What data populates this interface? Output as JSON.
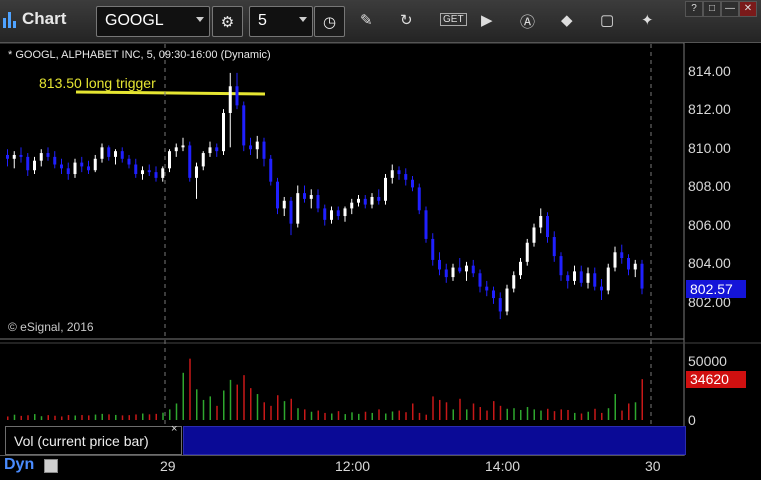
{
  "toolbar": {
    "app_title": "Chart",
    "symbol": "GOOGL",
    "interval": "5",
    "icons": [
      "chart-bars-icon",
      "symbol-dropdown-icon",
      "settings-gear-icon",
      "interval-dropdown-icon",
      "clock-icon",
      "draw-pencil-icon",
      "refresh-icon",
      "get-data-icon",
      "play-icon",
      "autoscale-a-icon",
      "tools-icon",
      "message-icon",
      "twitter-icon"
    ],
    "window_buttons": [
      "?",
      "□",
      "—",
      "✕"
    ]
  },
  "chart": {
    "header": "* GOOGL, ALPHABET INC, 5, 09:30-16:00 (Dynamic)",
    "annotation": "813.50 long trigger",
    "copyright": "© eSignal, 2016",
    "price_axis": [
      "814.00",
      "812.00",
      "810.00",
      "808.00",
      "806.00",
      "804.00",
      "802.00"
    ],
    "last_price": "802.57",
    "volume_axis": [
      "50000",
      "0"
    ],
    "last_volume": "34620",
    "volume_label": "Vol (current price bar)",
    "volume_close": "×",
    "time_axis": [
      "29",
      "12:00",
      "14:00",
      "30"
    ],
    "mode": "Dyn",
    "colors": {
      "up": "#ffffff",
      "down": "#2020ff",
      "annotation": "#e6e632",
      "vol_up": "#2ea82e",
      "vol_down": "#c81818",
      "price_tag": "#1414d8",
      "volume_tag": "#d01010"
    }
  },
  "chart_data": {
    "type": "candlestick",
    "symbol": "GOOGL",
    "interval_minutes": 5,
    "ylim": [
      801,
      814.5
    ],
    "ohlc": [
      [
        809.6,
        809.9,
        809.0,
        809.4
      ],
      [
        809.4,
        809.8,
        808.9,
        809.6
      ],
      [
        809.6,
        810.0,
        809.2,
        809.5
      ],
      [
        809.5,
        809.7,
        808.5,
        808.8
      ],
      [
        808.8,
        809.5,
        808.6,
        809.3
      ],
      [
        809.3,
        809.9,
        809.0,
        809.7
      ],
      [
        809.7,
        810.0,
        809.3,
        809.5
      ],
      [
        809.5,
        809.8,
        808.9,
        809.1
      ],
      [
        809.1,
        809.4,
        808.6,
        808.9
      ],
      [
        808.9,
        809.2,
        808.3,
        808.6
      ],
      [
        808.6,
        809.4,
        808.4,
        809.2
      ],
      [
        809.2,
        809.5,
        808.7,
        809.0
      ],
      [
        809.0,
        809.3,
        808.6,
        808.8
      ],
      [
        808.8,
        809.6,
        808.7,
        809.4
      ],
      [
        809.4,
        810.2,
        809.2,
        810.0
      ],
      [
        810.0,
        810.1,
        809.3,
        809.5
      ],
      [
        809.5,
        809.9,
        809.1,
        809.8
      ],
      [
        809.8,
        810.0,
        809.2,
        809.4
      ],
      [
        809.4,
        809.6,
        808.9,
        809.1
      ],
      [
        809.1,
        809.4,
        808.4,
        808.6
      ],
      [
        808.6,
        809.0,
        808.3,
        808.8
      ],
      [
        808.8,
        809.1,
        808.5,
        808.7
      ],
      [
        808.7,
        809.0,
        808.2,
        808.4
      ],
      [
        808.4,
        809.0,
        808.2,
        808.9
      ],
      [
        808.9,
        809.9,
        808.7,
        809.8
      ],
      [
        809.8,
        810.2,
        809.5,
        810.0
      ],
      [
        810.0,
        810.5,
        809.8,
        810.1
      ],
      [
        810.1,
        810.3,
        808.2,
        808.4
      ],
      [
        808.4,
        809.2,
        807.3,
        809.0
      ],
      [
        809.0,
        809.8,
        808.8,
        809.7
      ],
      [
        809.7,
        810.3,
        809.5,
        810.0
      ],
      [
        810.0,
        810.2,
        809.5,
        809.8
      ],
      [
        809.8,
        812.0,
        809.6,
        811.8
      ],
      [
        811.8,
        813.9,
        810.0,
        813.2
      ],
      [
        813.2,
        813.9,
        812.0,
        812.2
      ],
      [
        812.2,
        812.4,
        809.8,
        810.1
      ],
      [
        810.1,
        810.5,
        809.6,
        809.9
      ],
      [
        809.9,
        810.6,
        809.4,
        810.3
      ],
      [
        810.3,
        810.5,
        809.0,
        809.4
      ],
      [
        809.4,
        809.6,
        808.0,
        808.2
      ],
      [
        808.2,
        808.4,
        806.5,
        806.8
      ],
      [
        806.8,
        807.4,
        806.4,
        807.2
      ],
      [
        807.2,
        807.4,
        805.4,
        806.0
      ],
      [
        806.0,
        808.0,
        805.8,
        807.6
      ],
      [
        807.6,
        808.0,
        807.1,
        807.3
      ],
      [
        807.3,
        807.8,
        806.8,
        807.5
      ],
      [
        807.5,
        807.8,
        806.6,
        806.8
      ],
      [
        806.8,
        807.0,
        805.9,
        806.2
      ],
      [
        806.2,
        806.9,
        806.0,
        806.7
      ],
      [
        806.7,
        806.9,
        806.2,
        806.4
      ],
      [
        806.4,
        806.9,
        806.1,
        806.8
      ],
      [
        806.8,
        807.3,
        806.5,
        807.1
      ],
      [
        807.1,
        807.5,
        806.9,
        807.3
      ],
      [
        807.3,
        807.5,
        806.8,
        807.0
      ],
      [
        807.0,
        807.6,
        806.8,
        807.4
      ],
      [
        807.4,
        807.8,
        807.0,
        807.2
      ],
      [
        807.2,
        808.6,
        807.0,
        808.4
      ],
      [
        808.4,
        809.1,
        808.1,
        808.8
      ],
      [
        808.8,
        809.0,
        808.3,
        808.6
      ],
      [
        808.6,
        808.9,
        808.0,
        808.3
      ],
      [
        808.3,
        808.5,
        807.7,
        807.9
      ],
      [
        807.9,
        808.1,
        806.5,
        806.7
      ],
      [
        806.7,
        806.9,
        805.0,
        805.2
      ],
      [
        805.2,
        805.5,
        803.8,
        804.1
      ],
      [
        804.1,
        804.5,
        803.3,
        803.6
      ],
      [
        803.6,
        803.9,
        802.9,
        803.2
      ],
      [
        803.2,
        803.9,
        803.0,
        803.7
      ],
      [
        803.7,
        804.2,
        803.4,
        803.5
      ],
      [
        803.5,
        804.0,
        803.0,
        803.8
      ],
      [
        803.8,
        804.1,
        803.2,
        803.4
      ],
      [
        803.4,
        803.6,
        802.4,
        802.7
      ],
      [
        802.7,
        803.0,
        802.2,
        802.5
      ],
      [
        802.5,
        802.7,
        801.8,
        802.1
      ],
      [
        802.1,
        802.4,
        801.0,
        801.4
      ],
      [
        801.4,
        802.8,
        801.2,
        802.6
      ],
      [
        802.6,
        803.5,
        802.4,
        803.3
      ],
      [
        803.3,
        804.2,
        803.1,
        804.0
      ],
      [
        804.0,
        805.2,
        803.8,
        805.0
      ],
      [
        805.0,
        806.0,
        804.8,
        805.8
      ],
      [
        805.8,
        806.8,
        805.5,
        806.4
      ],
      [
        806.4,
        806.6,
        805.0,
        805.3
      ],
      [
        805.3,
        805.6,
        804.0,
        804.3
      ],
      [
        804.3,
        804.5,
        803.0,
        803.3
      ],
      [
        803.3,
        803.5,
        802.6,
        803.0
      ],
      [
        803.0,
        803.8,
        802.8,
        803.5
      ],
      [
        803.5,
        803.8,
        802.7,
        802.9
      ],
      [
        802.9,
        803.7,
        802.6,
        803.4
      ],
      [
        803.4,
        803.7,
        802.5,
        802.7
      ],
      [
        802.7,
        803.1,
        802.0,
        802.5
      ],
      [
        802.5,
        803.9,
        802.3,
        803.7
      ],
      [
        803.7,
        804.8,
        803.5,
        804.5
      ],
      [
        804.5,
        804.9,
        803.9,
        804.2
      ],
      [
        804.2,
        804.4,
        803.3,
        803.6
      ],
      [
        803.6,
        804.1,
        803.2,
        803.9
      ],
      [
        803.9,
        804.1,
        802.3,
        802.6
      ]
    ],
    "volume": [
      3000,
      4500,
      3500,
      4000,
      5000,
      3200,
      4100,
      3600,
      3000,
      4200,
      3800,
      4200,
      3900,
      4600,
      5200,
      4800,
      4300,
      3900,
      4100,
      4700,
      5500,
      4800,
      5200,
      6200,
      9000,
      14000,
      40000,
      52000,
      26000,
      17000,
      20000,
      12000,
      25000,
      34000,
      30000,
      38000,
      27000,
      22000,
      15000,
      12000,
      21000,
      16000,
      18000,
      10000,
      9000,
      7000,
      8000,
      6000,
      5500,
      7500,
      5000,
      6500,
      5200,
      7000,
      6000,
      9000,
      5500,
      7200,
      8000,
      6600,
      14000,
      6000,
      4500,
      20000,
      17000,
      15000,
      9000,
      18000,
      9000,
      14000,
      11000,
      8000,
      16000,
      12000,
      9500,
      10000,
      8500,
      11000,
      9000,
      8000,
      9500,
      7500,
      9000,
      8500,
      6000,
      5500,
      7000,
      9500,
      6000,
      10000,
      22000,
      8000,
      14000,
      15000,
      34620
    ],
    "time_axis_labels": [
      "29",
      "12:00",
      "14:00",
      "30"
    ],
    "last_price": 802.57,
    "last_volume": 34620
  }
}
